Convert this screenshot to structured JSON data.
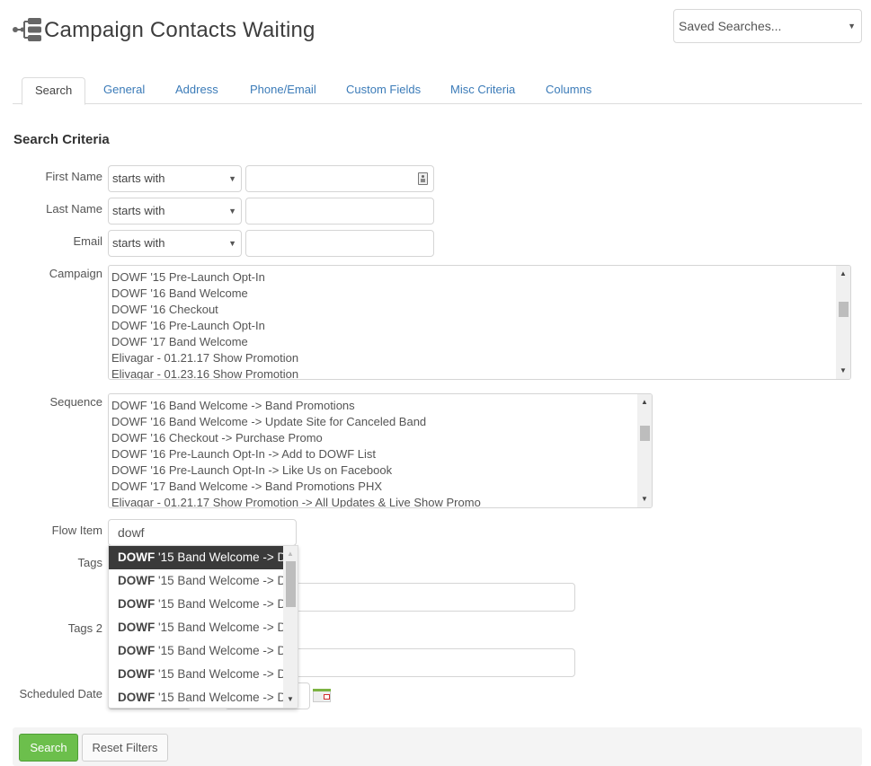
{
  "header": {
    "title": "Campaign Contacts Waiting",
    "title_icon": "flow-tree-icon",
    "saved_searches": {
      "value": "Saved Searches...",
      "icon": "caret-down-icon"
    }
  },
  "tabs": [
    {
      "label": "Search",
      "active": true
    },
    {
      "label": "General",
      "active": false
    },
    {
      "label": "Address",
      "active": false
    },
    {
      "label": "Phone/Email",
      "active": false
    },
    {
      "label": "Custom Fields",
      "active": false
    },
    {
      "label": "Misc Criteria",
      "active": false
    },
    {
      "label": "Columns",
      "active": false
    }
  ],
  "section_title": "Search Criteria",
  "fields": {
    "first_name": {
      "label": "First Name",
      "operator": "starts with",
      "value": "",
      "icon": "contact-card-icon"
    },
    "last_name": {
      "label": "Last Name",
      "operator": "starts with",
      "value": ""
    },
    "email": {
      "label": "Email",
      "operator": "starts with",
      "value": ""
    },
    "campaign": {
      "label": "Campaign",
      "items": [
        "DOWF '15 Pre-Launch Opt-In",
        "DOWF '16 Band Welcome",
        "DOWF '16 Checkout",
        "DOWF '16 Pre-Launch Opt-In",
        "DOWF '17 Band Welcome",
        "Elivagar - 01.21.17 Show Promotion",
        "Elivagar - 01.23.16 Show Promotion"
      ]
    },
    "sequence": {
      "label": "Sequence",
      "items": [
        "DOWF '16 Band Welcome -> Band Promotions",
        "DOWF '16 Band Welcome -> Update Site for Canceled Band",
        "DOWF '16 Checkout -> Purchase Promo",
        "DOWF '16 Pre-Launch Opt-In -> Add to DOWF List",
        "DOWF '16 Pre-Launch Opt-In -> Like Us on Facebook",
        "DOWF '17 Band Welcome -> Band Promotions PHX",
        "Elivagar - 01.21.17 Show Promotion -> All Updates & Live Show Promo"
      ]
    },
    "flow_item": {
      "label": "Flow Item",
      "value": "dowf",
      "suggestions": [
        {
          "match": "DOWF",
          "rest": " '15 Band Welcome -> D",
          "active": true
        },
        {
          "match": "DOWF",
          "rest": " '15 Band Welcome -> D",
          "active": false
        },
        {
          "match": "DOWF",
          "rest": " '15 Band Welcome -> D",
          "active": false
        },
        {
          "match": "DOWF",
          "rest": " '15 Band Welcome -> D",
          "active": false
        },
        {
          "match": "DOWF",
          "rest": " '15 Band Welcome -> D",
          "active": false
        },
        {
          "match": "DOWF",
          "rest": " '15 Band Welcome -> D",
          "active": false
        },
        {
          "match": "DOWF",
          "rest": " '15 Band Welcome -> D",
          "active": false
        }
      ]
    },
    "tags": {
      "label": "Tags",
      "value": ""
    },
    "tags2": {
      "label": "Tags 2",
      "value": ""
    },
    "scheduled_date": {
      "label": "Scheduled Date",
      "icon": "calendar-icon"
    }
  },
  "actions": {
    "search_label": "Search",
    "reset_label": "Reset Filters"
  },
  "colors": {
    "accent_link": "#3b7bb8",
    "search_button": "#6cbf4c",
    "autocomplete_active": "#3a3a3a"
  }
}
